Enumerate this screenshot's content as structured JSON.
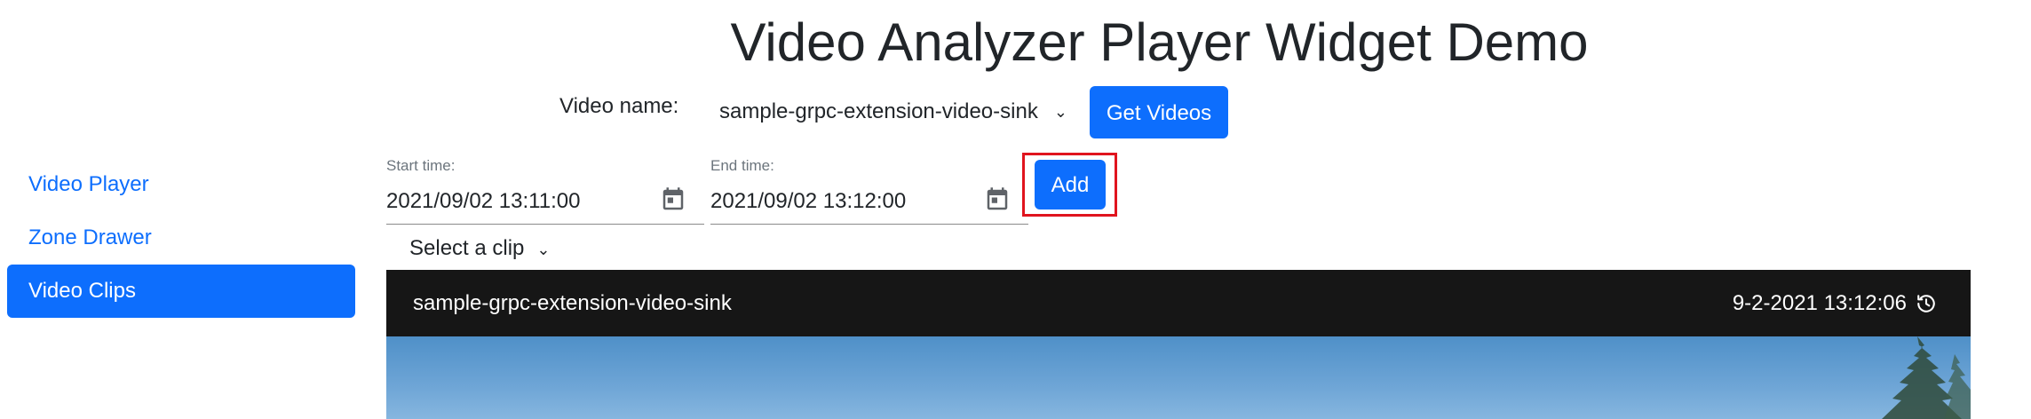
{
  "page": {
    "title": "Video Analyzer Player Widget Demo"
  },
  "sidebar": {
    "items": [
      {
        "label": "Video Player",
        "active": false
      },
      {
        "label": "Zone Drawer",
        "active": false
      },
      {
        "label": "Video Clips",
        "active": true
      }
    ]
  },
  "video_picker": {
    "label": "Video name:",
    "selected": "sample-grpc-extension-video-sink",
    "button_label": "Get Videos"
  },
  "clip_form": {
    "start_label": "Start time:",
    "start_value": "2021/09/02 13:11:00",
    "end_label": "End time:",
    "end_value": "2021/09/02 13:12:00",
    "add_label": "Add",
    "clip_select": "Select a clip"
  },
  "player": {
    "title": "sample-grpc-extension-video-sink",
    "timestamp": "9-2-2021 13:12:06"
  },
  "colors": {
    "accent": "#0d6efd",
    "highlight": "#e0141e",
    "player_bg": "#161616"
  }
}
